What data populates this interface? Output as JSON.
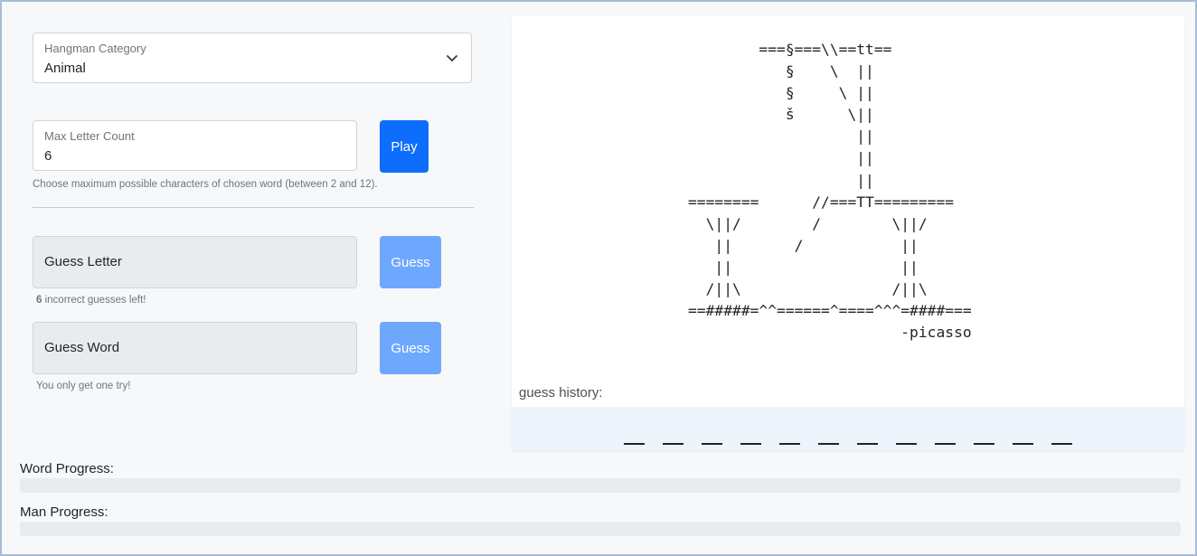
{
  "category": {
    "label": "Hangman Category",
    "value": "Animal"
  },
  "max_letters": {
    "label": "Max Letter Count",
    "value": "6",
    "help": "Choose maximum possible characters of chosen word (between 2 and 12).",
    "play_label": "Play"
  },
  "guess_letter": {
    "placeholder": "Guess Letter",
    "button_label": "Guess",
    "remaining_count": "6",
    "remaining_text": " incorrect guesses left!"
  },
  "guess_word": {
    "placeholder": "Guess Word",
    "button_label": "Guess",
    "help": "You only get one try!"
  },
  "art": "        ===§===\\\\==tt==\n           §    \\  ||\n           §     \\ ||\n           š      \\||\n                   ||\n                   ||\n                   ||\n========      //===TT=========\n  \\||/        /        \\||/\n   ||       /           ||\n   ||                   ||\n  /||\\                 /||\\\n==#####=^^======^====^^^=####===\n                        -picasso",
  "guess_history": {
    "label": "guess history:",
    "blank_count": 12
  },
  "word_progress": {
    "label": "Word Progress:",
    "percent": 0
  },
  "man_progress": {
    "label": "Man Progress:",
    "percent": 0
  },
  "colors": {
    "primary": "#0d6efd",
    "primary_disabled": "#6ea8fe",
    "track": "#e9ecef"
  }
}
